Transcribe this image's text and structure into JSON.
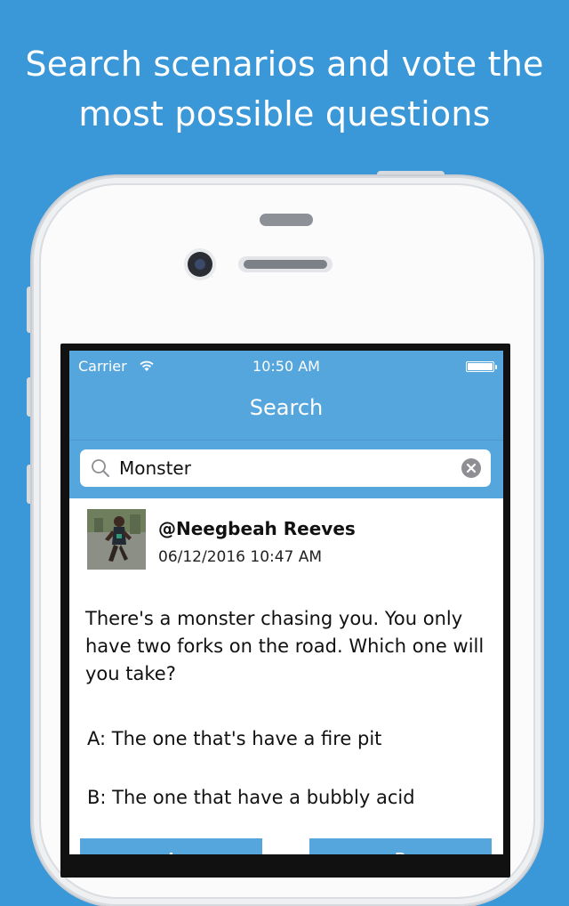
{
  "headline": {
    "line1": "Search scenarios and vote the",
    "line2": "most possible questions"
  },
  "status_bar": {
    "carrier": "Carrier",
    "time": "10:50 AM",
    "icons": [
      "wifi-icon",
      "battery-icon"
    ]
  },
  "nav": {
    "title": "Search"
  },
  "search": {
    "value": "Monster",
    "icons": [
      "search-icon",
      "clear-icon"
    ]
  },
  "post": {
    "username": "@Neegbeah Reeves",
    "timestamp": "06/12/2016 10:47 AM",
    "question": "There's a monster chasing you. You only have two forks on the road. Which one will you take?",
    "option_a": "A: The one that's have a fire pit",
    "option_b": "B: The one that have a bubbly acid",
    "vote_a_label": "A",
    "vote_b_label": "B"
  },
  "colors": {
    "background": "#3a97d8",
    "bar": "#56a6de",
    "text_light": "#ffffff"
  }
}
